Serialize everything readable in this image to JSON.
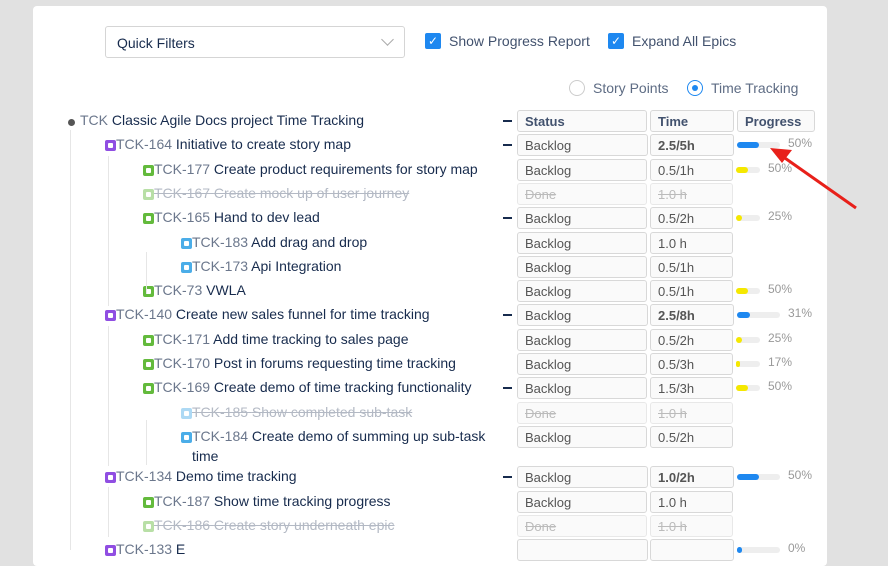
{
  "toolbar": {
    "quick_filters": "Quick Filters",
    "show_progress": "Show Progress Report",
    "expand_epics": "Expand All Epics",
    "story_points": "Story Points",
    "time_tracking": "Time Tracking"
  },
  "columns": {
    "status": "Status",
    "time": "Time",
    "progress": "Progress"
  },
  "root": {
    "id": "TCK",
    "title": "Classic Agile Docs project Time Tracking"
  },
  "colors": {
    "epic_bar": "#1e88f0",
    "story_bar": "#f5e800",
    "annotation": "#e8201a"
  },
  "rows": [
    {
      "level": 1,
      "type": "epic",
      "id": "TCK-164",
      "title": "Initiative to create story map",
      "status": "Backlog",
      "time": "2.5/5h",
      "progress": 50,
      "pct": "50%",
      "collapse": true
    },
    {
      "level": 2,
      "type": "story",
      "id": "TCK-177",
      "title": "Create product requirements for story map",
      "status": "Backlog",
      "time": "0.5/1h",
      "progress": 50,
      "pct": "50%"
    },
    {
      "level": 2,
      "type": "story",
      "id": "TCK-167",
      "title": "Create mock up of user journey",
      "status": "Done",
      "time": "1.0 h",
      "done": true
    },
    {
      "level": 2,
      "type": "story",
      "id": "TCK-165",
      "title": "Hand to dev lead",
      "status": "Backlog",
      "time": "0.5/2h",
      "progress": 25,
      "pct": "25%",
      "collapse": true
    },
    {
      "level": 3,
      "type": "sub",
      "id": "TCK-183",
      "title": "Add drag and drop",
      "status": "Backlog",
      "time": "1.0 h"
    },
    {
      "level": 3,
      "type": "sub",
      "id": "TCK-173",
      "title": "Api Integration",
      "status": "Backlog",
      "time": "0.5/1h"
    },
    {
      "level": 2,
      "type": "story",
      "id": "TCK-73",
      "title": "VWLA",
      "status": "Backlog",
      "time": "0.5/1h",
      "progress": 50,
      "pct": "50%"
    },
    {
      "level": 1,
      "type": "epic",
      "id": "TCK-140",
      "title": "Create new sales funnel for time tracking",
      "status": "Backlog",
      "time": "2.5/8h",
      "progress": 31,
      "pct": "31%",
      "collapse": true
    },
    {
      "level": 2,
      "type": "story",
      "id": "TCK-171",
      "title": "Add time tracking to sales page",
      "status": "Backlog",
      "time": "0.5/2h",
      "progress": 25,
      "pct": "25%"
    },
    {
      "level": 2,
      "type": "story",
      "id": "TCK-170",
      "title": "Post in forums requesting time tracking",
      "status": "Backlog",
      "time": "0.5/3h",
      "progress": 17,
      "pct": "17%"
    },
    {
      "level": 2,
      "type": "story",
      "id": "TCK-169",
      "title": "Create demo of time tracking functionality",
      "status": "Backlog",
      "time": "1.5/3h",
      "progress": 50,
      "pct": "50%",
      "collapse": true
    },
    {
      "level": 3,
      "type": "sub",
      "id": "TCK-185",
      "title": "Show completed sub-task",
      "status": "Done",
      "time": "1.0 h",
      "done": true
    },
    {
      "level": 3,
      "type": "sub",
      "id": "TCK-184",
      "title": "Create demo of summing up sub-task",
      "title2": "time",
      "status": "Backlog",
      "time": "0.5/2h"
    },
    {
      "level": 1,
      "type": "epic",
      "id": "TCK-134",
      "title": "Demo time tracking",
      "status": "Backlog",
      "time": "1.0/2h",
      "progress": 50,
      "pct": "50%",
      "collapse": true
    },
    {
      "level": 2,
      "type": "story",
      "id": "TCK-187",
      "title": "Show time tracking progress",
      "status": "Backlog",
      "time": "1.0 h"
    },
    {
      "level": 2,
      "type": "story",
      "id": "TCK-186",
      "title": "Create story underneath epic",
      "status": "Done",
      "time": "1.0 h",
      "done": true
    },
    {
      "level": 1,
      "type": "epic",
      "id": "TCK-133",
      "title": "E",
      "status": "",
      "time": "",
      "progress": 0,
      "pct": "0%"
    }
  ]
}
